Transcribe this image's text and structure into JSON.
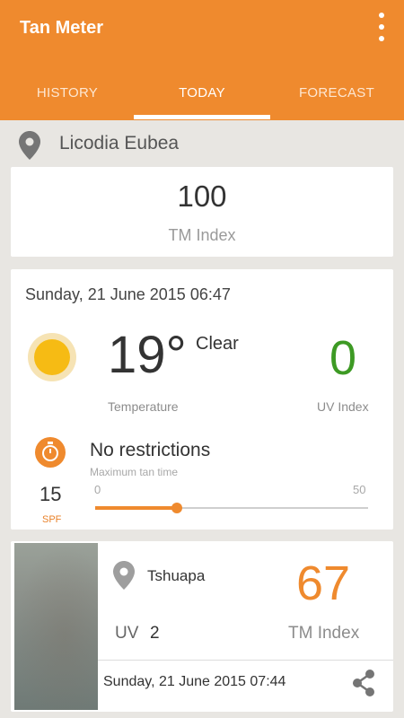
{
  "app": {
    "title": "Tan Meter"
  },
  "tabs": [
    {
      "label": "HISTORY",
      "active": false
    },
    {
      "label": "TODAY",
      "active": true
    },
    {
      "label": "FORECAST",
      "active": false
    }
  ],
  "location": {
    "name": "Licodia Eubea",
    "icon": "location-pin-icon"
  },
  "tm_card": {
    "value": "100",
    "label": "TM Index"
  },
  "weather_card": {
    "datetime": "Sunday, 21 June 2015 06:47",
    "temperature": "19°",
    "condition": "Clear",
    "temperature_label": "Temperature",
    "uv_value": "0",
    "uv_label": "UV Index",
    "icon": "sun-icon"
  },
  "tan_card": {
    "spf_value": "15",
    "spf_label": "SPF",
    "restriction": "No restrictions",
    "max_tan_label": "Maximum tan time",
    "slider_min": "0",
    "slider_max": "50",
    "slider_value": 15,
    "slider_range": [
      0,
      50
    ],
    "icon": "stopwatch-icon"
  },
  "history_item": {
    "place": "Tshuapa",
    "tm_value": "67",
    "tm_label": "TM Index",
    "uv_label": "UV",
    "uv_value": "2",
    "datetime": "Sunday, 21 June 2015 07:44",
    "share_icon": "share-icon"
  },
  "colors": {
    "accent": "#ef8a2e",
    "uv_green": "#3d9a24",
    "background": "#e8e6e2"
  }
}
